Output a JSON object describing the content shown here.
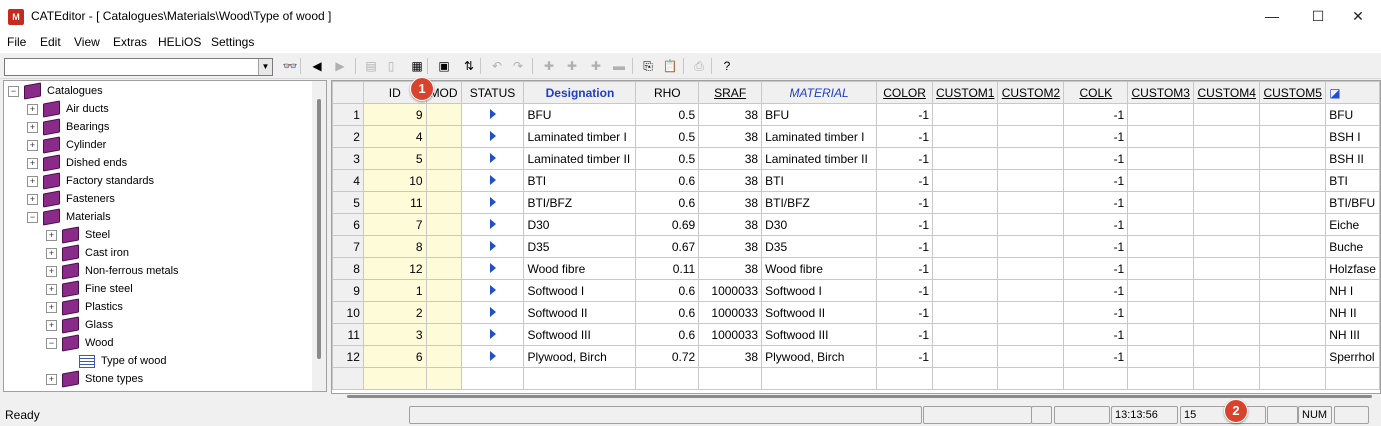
{
  "window": {
    "icon_label": "M",
    "title": "CATEditor - [ Catalogues\\Materials\\Wood\\Type of wood ]",
    "minimize_glyph": "—",
    "maximize_glyph": "☐",
    "close_glyph": "✕"
  },
  "menu": [
    "File",
    "Edit",
    "View",
    "Extras",
    "HELiOS",
    "Settings"
  ],
  "toolbar": {
    "combo_value": "",
    "combo_arrow": "▼",
    "buttons": [
      {
        "icon": "binoculars-icon",
        "glyph": "👓",
        "enabled": true
      },
      {
        "icon": "back-icon",
        "glyph": "◀",
        "enabled": true
      },
      {
        "icon": "forward-icon",
        "glyph": "▶",
        "enabled": false
      },
      {
        "icon": "doc-stack-icon",
        "glyph": "▤",
        "enabled": false
      },
      {
        "icon": "document-icon",
        "glyph": "▯",
        "enabled": false
      },
      {
        "icon": "table-edit-icon",
        "glyph": "▦",
        "enabled": true
      },
      {
        "icon": "save-icon",
        "glyph": "▣",
        "enabled": true
      },
      {
        "icon": "sort-icon",
        "glyph": "⇅",
        "enabled": true
      },
      {
        "icon": "undo-icon",
        "glyph": "↶",
        "enabled": false
      },
      {
        "icon": "redo-icon",
        "glyph": "↷",
        "enabled": false
      },
      {
        "icon": "insert-row-icon",
        "glyph": "✚",
        "enabled": false
      },
      {
        "icon": "insert-col-icon",
        "glyph": "✚",
        "enabled": false
      },
      {
        "icon": "add-icon",
        "glyph": "✚",
        "enabled": false
      },
      {
        "icon": "remove-icon",
        "glyph": "▬",
        "enabled": false
      },
      {
        "icon": "copy-icon",
        "glyph": "⎘",
        "enabled": true
      },
      {
        "icon": "paste-icon",
        "glyph": "📋",
        "enabled": true
      },
      {
        "icon": "print-icon",
        "glyph": "⎙",
        "enabled": false
      },
      {
        "icon": "help-icon",
        "glyph": "?",
        "enabled": true
      }
    ]
  },
  "tree": {
    "items": [
      {
        "label": "Catalogues",
        "level": 0,
        "expander": "−",
        "icon": "book"
      },
      {
        "label": "Air ducts",
        "level": 1,
        "expander": "+",
        "icon": "book"
      },
      {
        "label": "Bearings",
        "level": 1,
        "expander": "+",
        "icon": "book"
      },
      {
        "label": "Cylinder",
        "level": 1,
        "expander": "+",
        "icon": "book"
      },
      {
        "label": "Dished ends",
        "level": 1,
        "expander": "+",
        "icon": "book"
      },
      {
        "label": "Factory standards",
        "level": 1,
        "expander": "+",
        "icon": "book"
      },
      {
        "label": "Fasteners",
        "level": 1,
        "expander": "+",
        "icon": "book"
      },
      {
        "label": "Materials",
        "level": 1,
        "expander": "−",
        "icon": "book"
      },
      {
        "label": "Steel",
        "level": 2,
        "expander": "+",
        "icon": "book"
      },
      {
        "label": "Cast iron",
        "level": 2,
        "expander": "+",
        "icon": "book"
      },
      {
        "label": "Non-ferrous metals",
        "level": 2,
        "expander": "+",
        "icon": "book"
      },
      {
        "label": "Fine steel",
        "level": 2,
        "expander": "+",
        "icon": "book"
      },
      {
        "label": "Plastics",
        "level": 2,
        "expander": "+",
        "icon": "book"
      },
      {
        "label": "Glass",
        "level": 2,
        "expander": "+",
        "icon": "book"
      },
      {
        "label": "Wood",
        "level": 2,
        "expander": "−",
        "icon": "book"
      },
      {
        "label": "Type of wood",
        "level": 3,
        "expander": "",
        "icon": "table"
      },
      {
        "label": "Stone types",
        "level": 2,
        "expander": "+",
        "icon": "book"
      }
    ]
  },
  "grid": {
    "columns": [
      "",
      "ID",
      "MOD",
      "STATUS",
      "Designation",
      "RHO",
      "SRAF",
      "MATERIAL",
      "COLOR",
      "CUSTOM1",
      "CUSTOM2",
      "COLK",
      "CUSTOM3",
      "CUSTOM4",
      "CUSTOM5",
      ""
    ],
    "corner_glyph": "◪",
    "rows": [
      [
        "1",
        "9",
        "",
        "",
        "BFU",
        "0.5",
        "38",
        "BFU",
        "-1",
        "",
        "",
        "-1",
        "",
        "",
        "",
        "BFU"
      ],
      [
        "2",
        "4",
        "",
        "",
        "Laminated timber I",
        "0.5",
        "38",
        "Laminated timber I",
        "-1",
        "",
        "",
        "-1",
        "",
        "",
        "",
        "BSH I"
      ],
      [
        "3",
        "5",
        "",
        "",
        "Laminated timber II",
        "0.5",
        "38",
        "Laminated timber II",
        "-1",
        "",
        "",
        "-1",
        "",
        "",
        "",
        "BSH II"
      ],
      [
        "4",
        "10",
        "",
        "",
        "BTI",
        "0.6",
        "38",
        "BTI",
        "-1",
        "",
        "",
        "-1",
        "",
        "",
        "",
        "BTI"
      ],
      [
        "5",
        "11",
        "",
        "",
        "BTI/BFZ",
        "0.6",
        "38",
        "BTI/BFZ",
        "-1",
        "",
        "",
        "-1",
        "",
        "",
        "",
        "BTI/BFU"
      ],
      [
        "6",
        "7",
        "",
        "",
        "D30",
        "0.69",
        "38",
        "D30",
        "-1",
        "",
        "",
        "-1",
        "",
        "",
        "",
        "Eiche"
      ],
      [
        "7",
        "8",
        "",
        "",
        "D35",
        "0.67",
        "38",
        "D35",
        "-1",
        "",
        "",
        "-1",
        "",
        "",
        "",
        "Buche"
      ],
      [
        "8",
        "12",
        "",
        "",
        "Wood fibre",
        "0.11",
        "38",
        "Wood fibre",
        "-1",
        "",
        "",
        "-1",
        "",
        "",
        "",
        "Holzfase"
      ],
      [
        "9",
        "1",
        "",
        "",
        "Softwood I",
        "0.6",
        "1000033",
        "Softwood I",
        "-1",
        "",
        "",
        "-1",
        "",
        "",
        "",
        "NH I"
      ],
      [
        "10",
        "2",
        "",
        "",
        "Softwood II",
        "0.6",
        "1000033",
        "Softwood II",
        "-1",
        "",
        "",
        "-1",
        "",
        "",
        "",
        "NH II"
      ],
      [
        "11",
        "3",
        "",
        "",
        "Softwood III",
        "0.6",
        "1000033",
        "Softwood III",
        "-1",
        "",
        "",
        "-1",
        "",
        "",
        "",
        "NH III"
      ],
      [
        "12",
        "6",
        "",
        "",
        "Plywood, Birch",
        "0.72",
        "38",
        "Plywood, Birch",
        "-1",
        "",
        "",
        "-1",
        "",
        "",
        "",
        "Sperrhol"
      ]
    ]
  },
  "status": {
    "ready": "Ready",
    "time": "13:13:56",
    "count": "15",
    "num": "NUM"
  },
  "badges": [
    "1",
    "2"
  ]
}
